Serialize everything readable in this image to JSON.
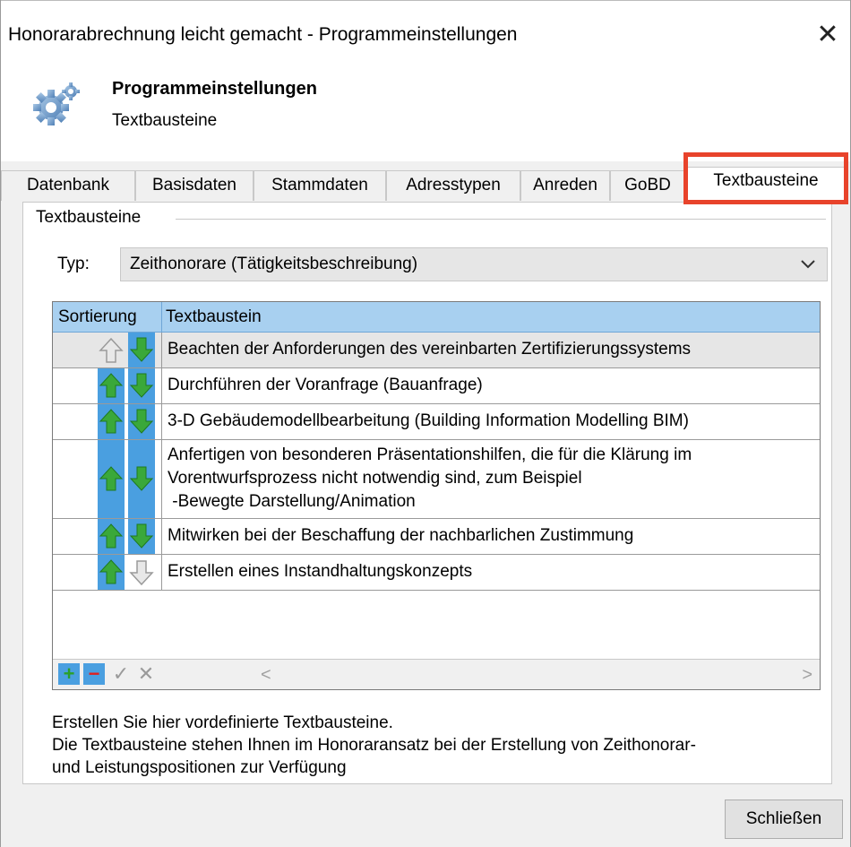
{
  "window": {
    "title": "Honorarabrechnung leicht gemacht - Programmeinstellungen",
    "close_symbol": "✕"
  },
  "header": {
    "icon": "gear-icon",
    "title": "Programmeinstellungen",
    "subtitle": "Textbausteine"
  },
  "tabs": [
    {
      "label": "Datenbank",
      "active": false
    },
    {
      "label": "Basisdaten",
      "active": false
    },
    {
      "label": "Stammdaten",
      "active": false
    },
    {
      "label": "Adresstypen",
      "active": false
    },
    {
      "label": "Anreden",
      "active": false
    },
    {
      "label": "GoBD",
      "active": false
    },
    {
      "label": "Textbausteine",
      "active": true
    }
  ],
  "group": {
    "label": "Textbausteine",
    "type_label": "Typ:",
    "type_value": "Zeithonorare (Tätigkeitsbeschreibung)"
  },
  "grid": {
    "columns": [
      "Sortierung",
      "Textbaustein"
    ],
    "rows": [
      {
        "text": "Beachten der Anforderungen des vereinbarten Zertifizierungssystems",
        "up_enabled": false,
        "down_enabled": true,
        "selected": true
      },
      {
        "text": "Durchführen der Voranfrage (Bauanfrage)",
        "up_enabled": true,
        "down_enabled": true,
        "selected": false
      },
      {
        "text": "3-D Gebäudemodellbearbeitung (Building Information Modelling BIM)",
        "up_enabled": true,
        "down_enabled": true,
        "selected": false
      },
      {
        "text_lines": [
          "Anfertigen von besonderen Präsentationshilfen, die für die Klärung im",
          "Vorentwurfsprozess nicht notwendig sind, zum Beispiel",
          " -Bewegte Darstellung/Animation"
        ],
        "up_enabled": true,
        "down_enabled": true,
        "selected": false
      },
      {
        "text": "Mitwirken bei der Beschaffung der nachbarlichen Zustimmung",
        "up_enabled": true,
        "down_enabled": true,
        "selected": false
      },
      {
        "text": "Erstellen eines Instandhaltungskonzepts",
        "up_enabled": true,
        "down_enabled": false,
        "selected": false
      }
    ],
    "footer": {
      "add": "+",
      "remove": "−",
      "confirm": "✓",
      "cancel": "✕",
      "scroll_left": "<",
      "scroll_right": ">"
    }
  },
  "info": {
    "lines": [
      "Erstellen Sie hier vordefinierte Textbausteine.",
      "Die Textbausteine stehen Ihnen im Honoraransatz bei der Erstellung von Zeithonorar-",
      "und Leistungspositionen zur Verfügung"
    ]
  },
  "buttons": {
    "close": "Schließen"
  },
  "colors": {
    "highlight": "#e8432b",
    "grid_header": "#a8d0f0",
    "arrow_green": "#3aa83a",
    "arrow_bg": "#4a9fe0"
  }
}
